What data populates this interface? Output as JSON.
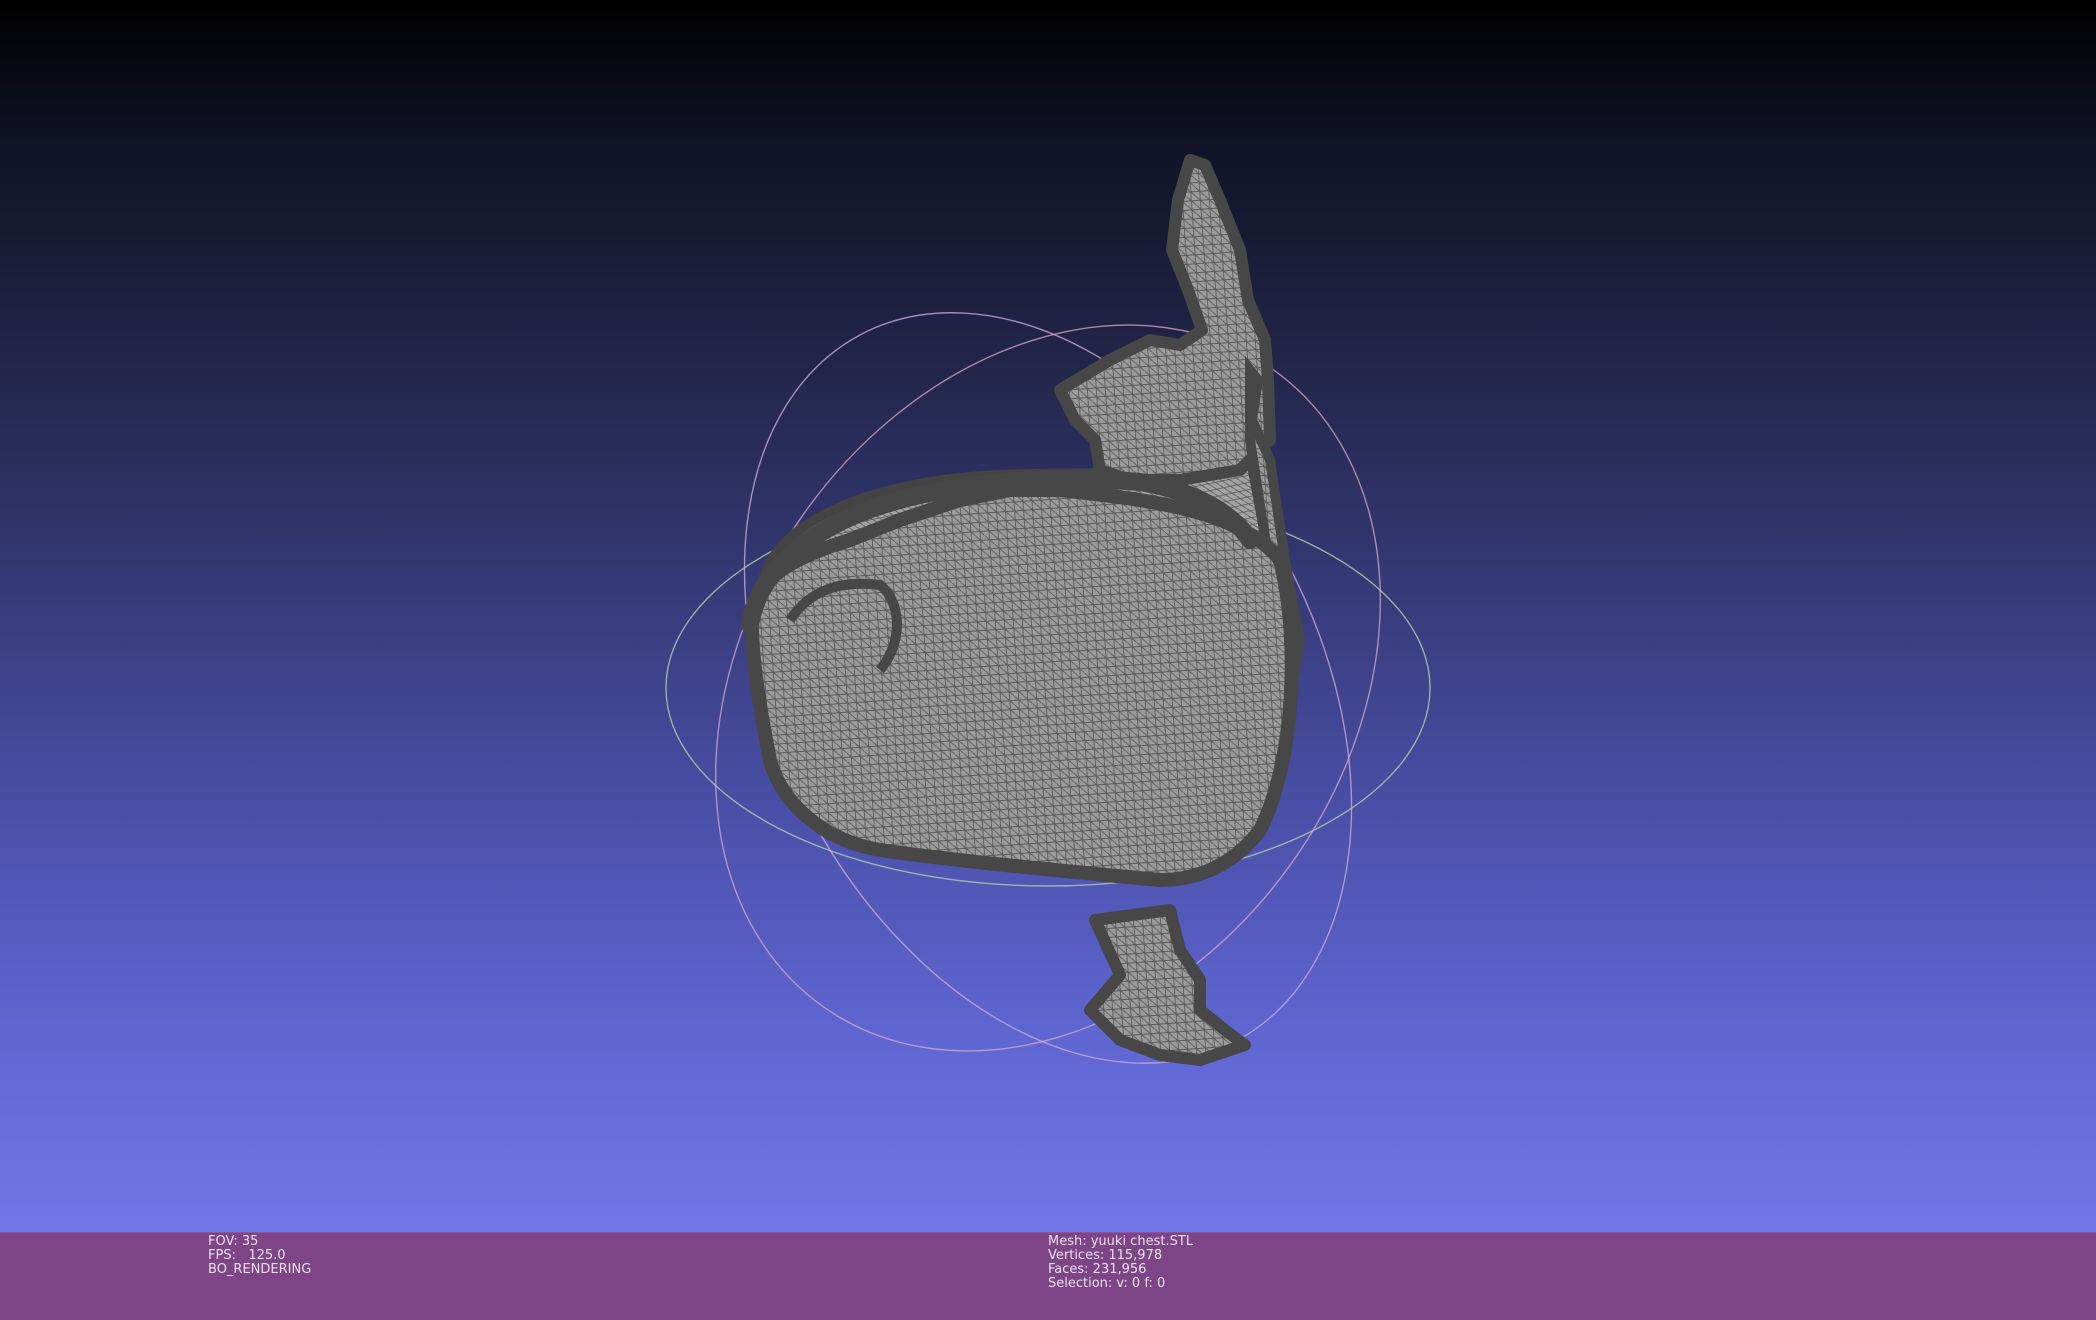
{
  "viewer": {
    "background_top": "#000000",
    "background_bottom": "#7276e8",
    "statusbar_color": "#7d4585",
    "mesh_color": "#8e8e8e",
    "mesh_outline_color": "#4a4a4a",
    "trackball_colors": [
      "#c8a0d8",
      "#b0c8b0",
      "#d0a0c8"
    ]
  },
  "left_info": {
    "fov": "FOV: 35",
    "fps": "FPS:   125.0",
    "mode": "BO_RENDERING"
  },
  "mesh_info": {
    "mesh": "Mesh: yuuki chest.STL",
    "vertices": "Vertices: 115,978",
    "faces": "Faces: 231,956",
    "selection": "Selection: v: 0 f: 0"
  }
}
